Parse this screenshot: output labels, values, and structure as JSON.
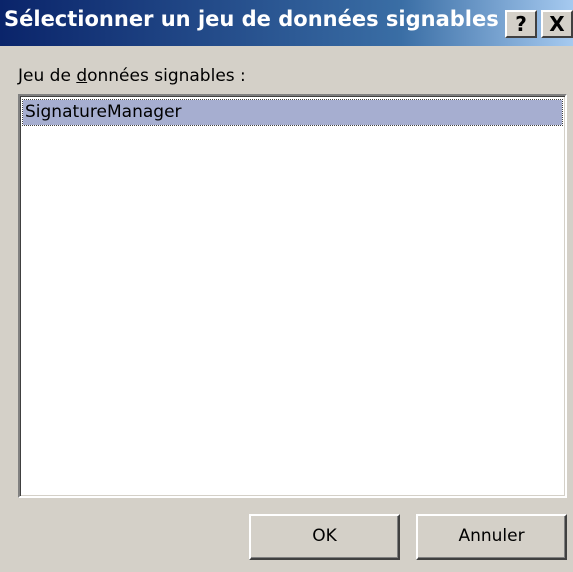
{
  "dialog": {
    "title": "Sélectionner un jeu de données signables",
    "help_label": "?",
    "close_label": "X",
    "field_label_prefix": "Jeu de ",
    "field_label_accel": "d",
    "field_label_suffix": "onnées signables :",
    "list_items": [
      "SignatureManager"
    ],
    "selected_index": 0,
    "ok_label": "OK",
    "cancel_label": "Annuler"
  },
  "colors": {
    "title_gradient_start": "#0a246a",
    "title_gradient_end": "#a6caf0",
    "dialog_face": "#d4d0c8",
    "selection": "#a6aed0"
  }
}
